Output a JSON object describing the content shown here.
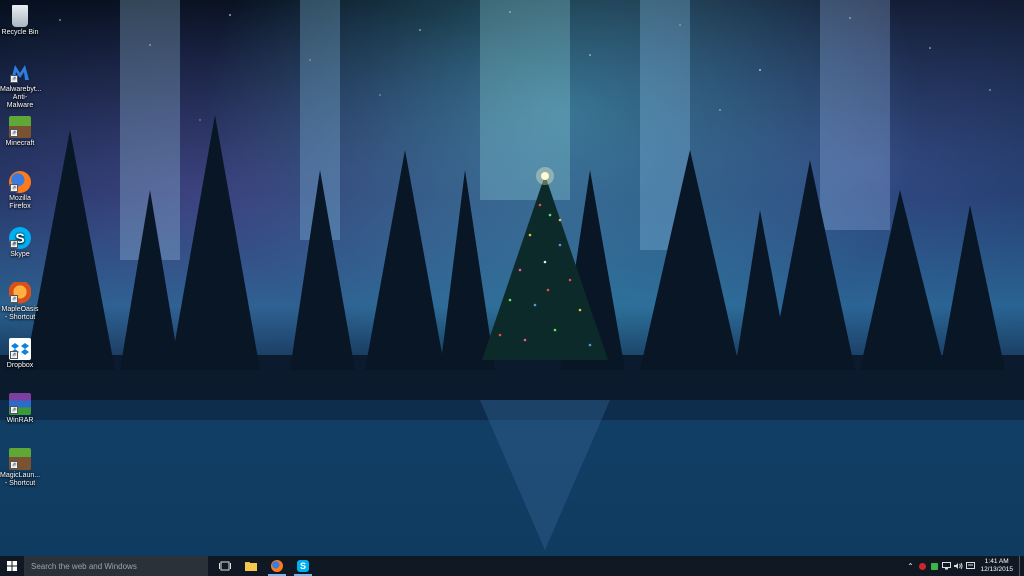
{
  "desktop": {
    "icons": [
      {
        "label": "Recycle Bin",
        "icon": "recycle-bin-icon"
      },
      {
        "label": "Malwarebyt... Anti-Malware",
        "icon": "malwarebytes-icon"
      },
      {
        "label": "Minecraft",
        "icon": "minecraft-icon"
      },
      {
        "label": "Mozilla Firefox",
        "icon": "firefox-icon"
      },
      {
        "label": "Skype",
        "icon": "skype-icon"
      },
      {
        "label": "MapleOasis - Shortcut",
        "icon": "mapleoasis-icon"
      },
      {
        "label": "Dropbox",
        "icon": "dropbox-icon"
      },
      {
        "label": "WinRAR",
        "icon": "winrar-icon"
      },
      {
        "label": "MagicLaun... - Shortcut",
        "icon": "magiclauncher-icon"
      }
    ]
  },
  "taskbar": {
    "search_placeholder": "Search the web and Windows",
    "pinned": [
      {
        "name": "task-view",
        "icon": "task-view-icon"
      },
      {
        "name": "file-explorer",
        "icon": "folder-icon"
      },
      {
        "name": "firefox",
        "icon": "firefox-icon",
        "active": true
      },
      {
        "name": "skype",
        "icon": "skype-icon",
        "active": true
      }
    ],
    "tray": {
      "time": "1:41 AM",
      "date": "12/13/2015"
    }
  },
  "colors": {
    "taskbar_bg": "#101923",
    "search_bg": "#2b3138",
    "accent": "#7fb2e6"
  }
}
